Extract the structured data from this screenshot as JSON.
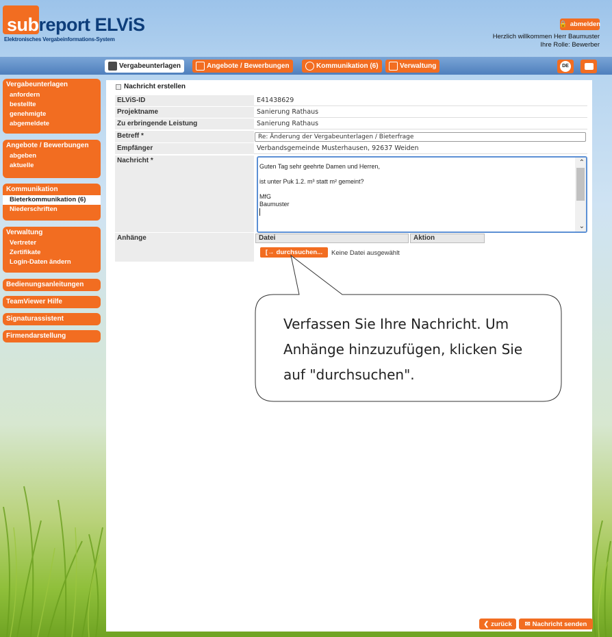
{
  "header": {
    "logo_sub": "sub",
    "logo_rest": "report ELViS",
    "logo_tagline": "Elektronisches Vergabeinformations-System",
    "logout_label": "abmelden",
    "welcome_line": "Herzlich willkommen Herr Baumuster",
    "role_line": "Ihre Rolle: Bewerber"
  },
  "nav": {
    "tabs": [
      {
        "label": "Vergabeunterlagen"
      },
      {
        "label": "Angebote / Bewerbungen"
      },
      {
        "label": "Kommunikation (6)"
      },
      {
        "label": "Verwaltung"
      }
    ],
    "lang_label": "DE"
  },
  "sidebar": {
    "groups": [
      {
        "title": "Vergabeunterlagen",
        "items": [
          "anfordern",
          "bestellte",
          "genehmigte",
          "abgemeldete"
        ]
      },
      {
        "title": "Angebote / Bewerbungen",
        "items": [
          "abgeben",
          "aktuelle"
        ]
      },
      {
        "title": "Kommunikation",
        "items": [
          "Bieterkommunikation (6)",
          "Niederschriften"
        ]
      },
      {
        "title": "Verwaltung",
        "items": [
          "Vertreter",
          "Zertifikate",
          "Login-Daten ändern"
        ]
      },
      {
        "title": "Bedienungsanleitungen",
        "items": []
      },
      {
        "title": "TeamViewer Hilfe",
        "items": []
      },
      {
        "title": "Signaturassistent",
        "items": []
      },
      {
        "title": "Firmendarstellung",
        "items": []
      }
    ]
  },
  "form": {
    "title": "Nachricht erstellen",
    "elvis_id_label": "ELViS-ID",
    "elvis_id_value": "E41438629",
    "project_label": "Projektname",
    "project_value": "Sanierung Rathaus",
    "service_label": "Zu erbringende Leistung",
    "service_value": "Sanierung Rathaus",
    "subject_label": "Betreff *",
    "subject_value": "Re: Änderung der Vergabeunterlagen / Bieterfrage",
    "recipient_label": "Empfänger",
    "recipient_value": "Verbandsgemeinde Musterhausen, 92637 Weiden",
    "message_label": "Nachricht *",
    "message_lines": [
      "Guten Tag sehr geehrte Damen und Herren,",
      "",
      "ist unter Puk 1.2. m³ statt m² gemeint?",
      "",
      "MfG",
      "Baumuster"
    ],
    "attachments_label": "Anhänge",
    "attachments_col_file": "Datei",
    "attachments_col_action": "Aktion",
    "browse_label": "durchsuchen...",
    "no_file_label": "Keine Datei ausgewählt"
  },
  "callout": {
    "line1": "Verfassen Sie Ihre Nachricht. Um",
    "line2": "Anhänge hinzuzufügen, klicken Sie",
    "line3": "auf \"durchsuchen\"."
  },
  "footer": {
    "back_label": "zurück",
    "send_label": "Nachricht senden"
  },
  "colors": {
    "accent": "#f26d21",
    "brand_blue": "#0d3d7a",
    "nav_blue": "#5b88c4"
  }
}
